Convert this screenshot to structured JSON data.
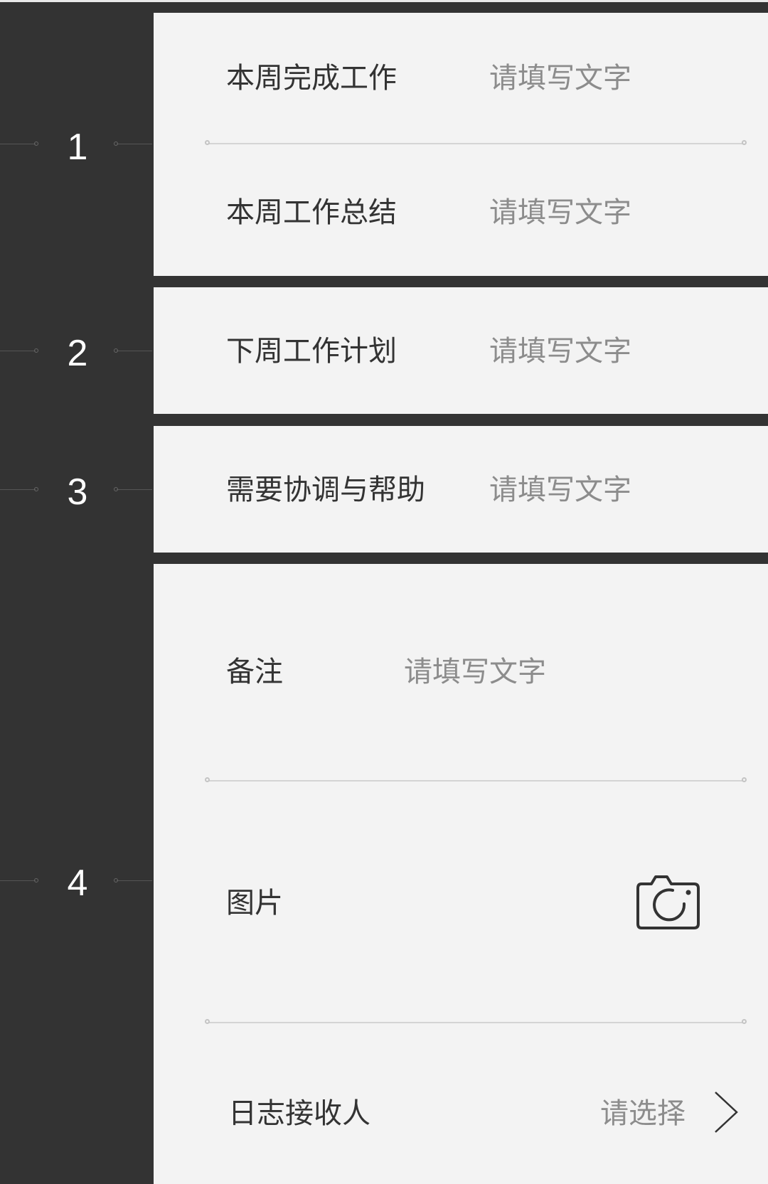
{
  "steps": [
    "1",
    "2",
    "3",
    "4"
  ],
  "fields": {
    "completed_work": {
      "label": "本周完成工作",
      "placeholder": "请填写文字"
    },
    "work_summary": {
      "label": "本周工作总结",
      "placeholder": "请填写文字"
    },
    "next_week_plan": {
      "label": "下周工作计划",
      "placeholder": "请填写文字"
    },
    "coordination": {
      "label": "需要协调与帮助",
      "placeholder": "请填写文字"
    },
    "remarks": {
      "label": "备注",
      "placeholder": "请填写文字"
    },
    "images": {
      "label": "图片",
      "icon": "camera-icon"
    },
    "recipient": {
      "label": "日志接收人",
      "placeholder": "请选择",
      "icon": "chevron-right-icon"
    }
  },
  "colors": {
    "background": "#333333",
    "card": "#f3f3f3",
    "label": "#333333",
    "placeholder": "#8c8c8c",
    "divider": "#d4d4d4"
  }
}
